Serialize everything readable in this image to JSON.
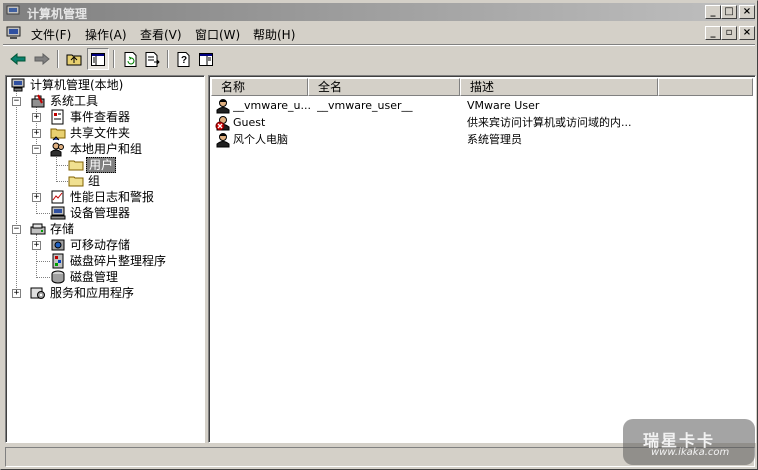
{
  "window": {
    "title": "计算机管理"
  },
  "menu": [
    "文件(F)",
    "操作(A)",
    "查看(V)",
    "窗口(W)",
    "帮助(H)"
  ],
  "tree": {
    "root": "计算机管理(本地)",
    "system_tools": "系统工具",
    "event_viewer": "事件查看器",
    "shared_folders": "共享文件夹",
    "local_users_groups": "本地用户和组",
    "users": "用户",
    "groups": "组",
    "perf_logs": "性能日志和警报",
    "device_manager": "设备管理器",
    "storage": "存储",
    "removable_storage": "可移动存储",
    "defrag": "磁盘碎片整理程序",
    "disk_mgmt": "磁盘管理",
    "services_apps": "服务和应用程序"
  },
  "list": {
    "columns": [
      "名称",
      "全名",
      "描述"
    ],
    "rows": [
      {
        "name": "__vmware_u...",
        "full_name": "__vmware_user__",
        "description": "VMware User",
        "disabled": false
      },
      {
        "name": "Guest",
        "full_name": "",
        "description": "供来宾访问计算机或访问域的内...",
        "disabled": true
      },
      {
        "name": "风个人电脑",
        "full_name": "",
        "description": "系统管理员",
        "disabled": false
      }
    ]
  },
  "watermark": {
    "brand": "瑞星卡卡",
    "url": "www.ikaka.com"
  },
  "colors": {
    "selection": "#808080",
    "face": "#d4d0c8",
    "title_gradient_start": "#808080"
  },
  "icons": [
    "computer-icon",
    "back-arrow-icon",
    "forward-arrow-icon",
    "up-folder-icon",
    "show-hide-tree-icon",
    "refresh-icon",
    "export-list-icon",
    "help-icon",
    "mmc-icon",
    "folder-icon",
    "user-icon"
  ]
}
